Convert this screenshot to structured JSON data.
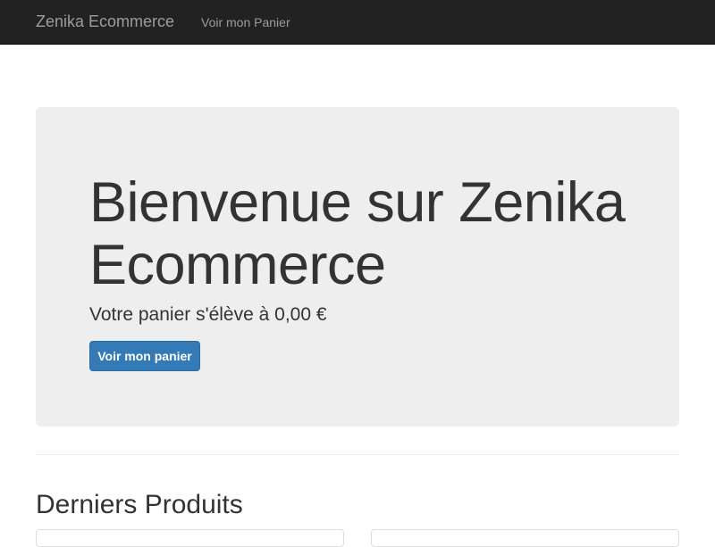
{
  "navbar": {
    "brand": "Zenika Ecommerce",
    "cart_link": "Voir mon Panier"
  },
  "jumbotron": {
    "title": "Bienvenue sur Zenika Ecommerce",
    "cart_summary": "Votre panier s'élève à 0,00 €",
    "cart_button": "Voir mon panier"
  },
  "products": {
    "heading": "Derniers Produits"
  },
  "colors": {
    "navbar_bg": "#222222",
    "navbar_text": "#9d9d9d",
    "jumbotron_bg": "#eeeeee",
    "primary": "#337ab7"
  }
}
